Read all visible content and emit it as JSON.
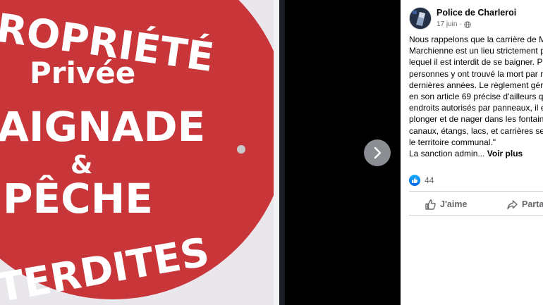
{
  "photo": {
    "sign_lines": [
      "ROPRIÉTÉ",
      "Privée",
      "AIGNADE",
      "&",
      "PÊCHE",
      "TERDITES"
    ],
    "sign_color": "#c8363a"
  },
  "viewer": {
    "next_icon": "chevron-right-icon"
  },
  "post": {
    "page_name": "Police de Charleroi",
    "date": "17 juin",
    "separator": "·",
    "privacy_icon": "globe-icon",
    "lines": [
      "Nous rappelons que la carrière de M",
      "Marchienne est un lieu strictement p",
      "lequel il est interdit de se baigner. P",
      "personnes y ont trouvé la mort par n",
      "dernières années. Le règlement géné",
      "en son article 69 précise d'ailleurs qu",
      "endroits autorisés par panneaux, il e",
      "plonger et de nager dans les fontain",
      "canaux, étangs, lacs, et carrières se t",
      "le territoire communal.\""
    ],
    "last_line": "La sanction admin...",
    "see_more": "Voir plus",
    "reaction_count": "44",
    "like_label": "J'aime",
    "share_label": "Partag"
  },
  "colors": {
    "accent": "#1877f2",
    "secondary_text": "#65676b"
  }
}
